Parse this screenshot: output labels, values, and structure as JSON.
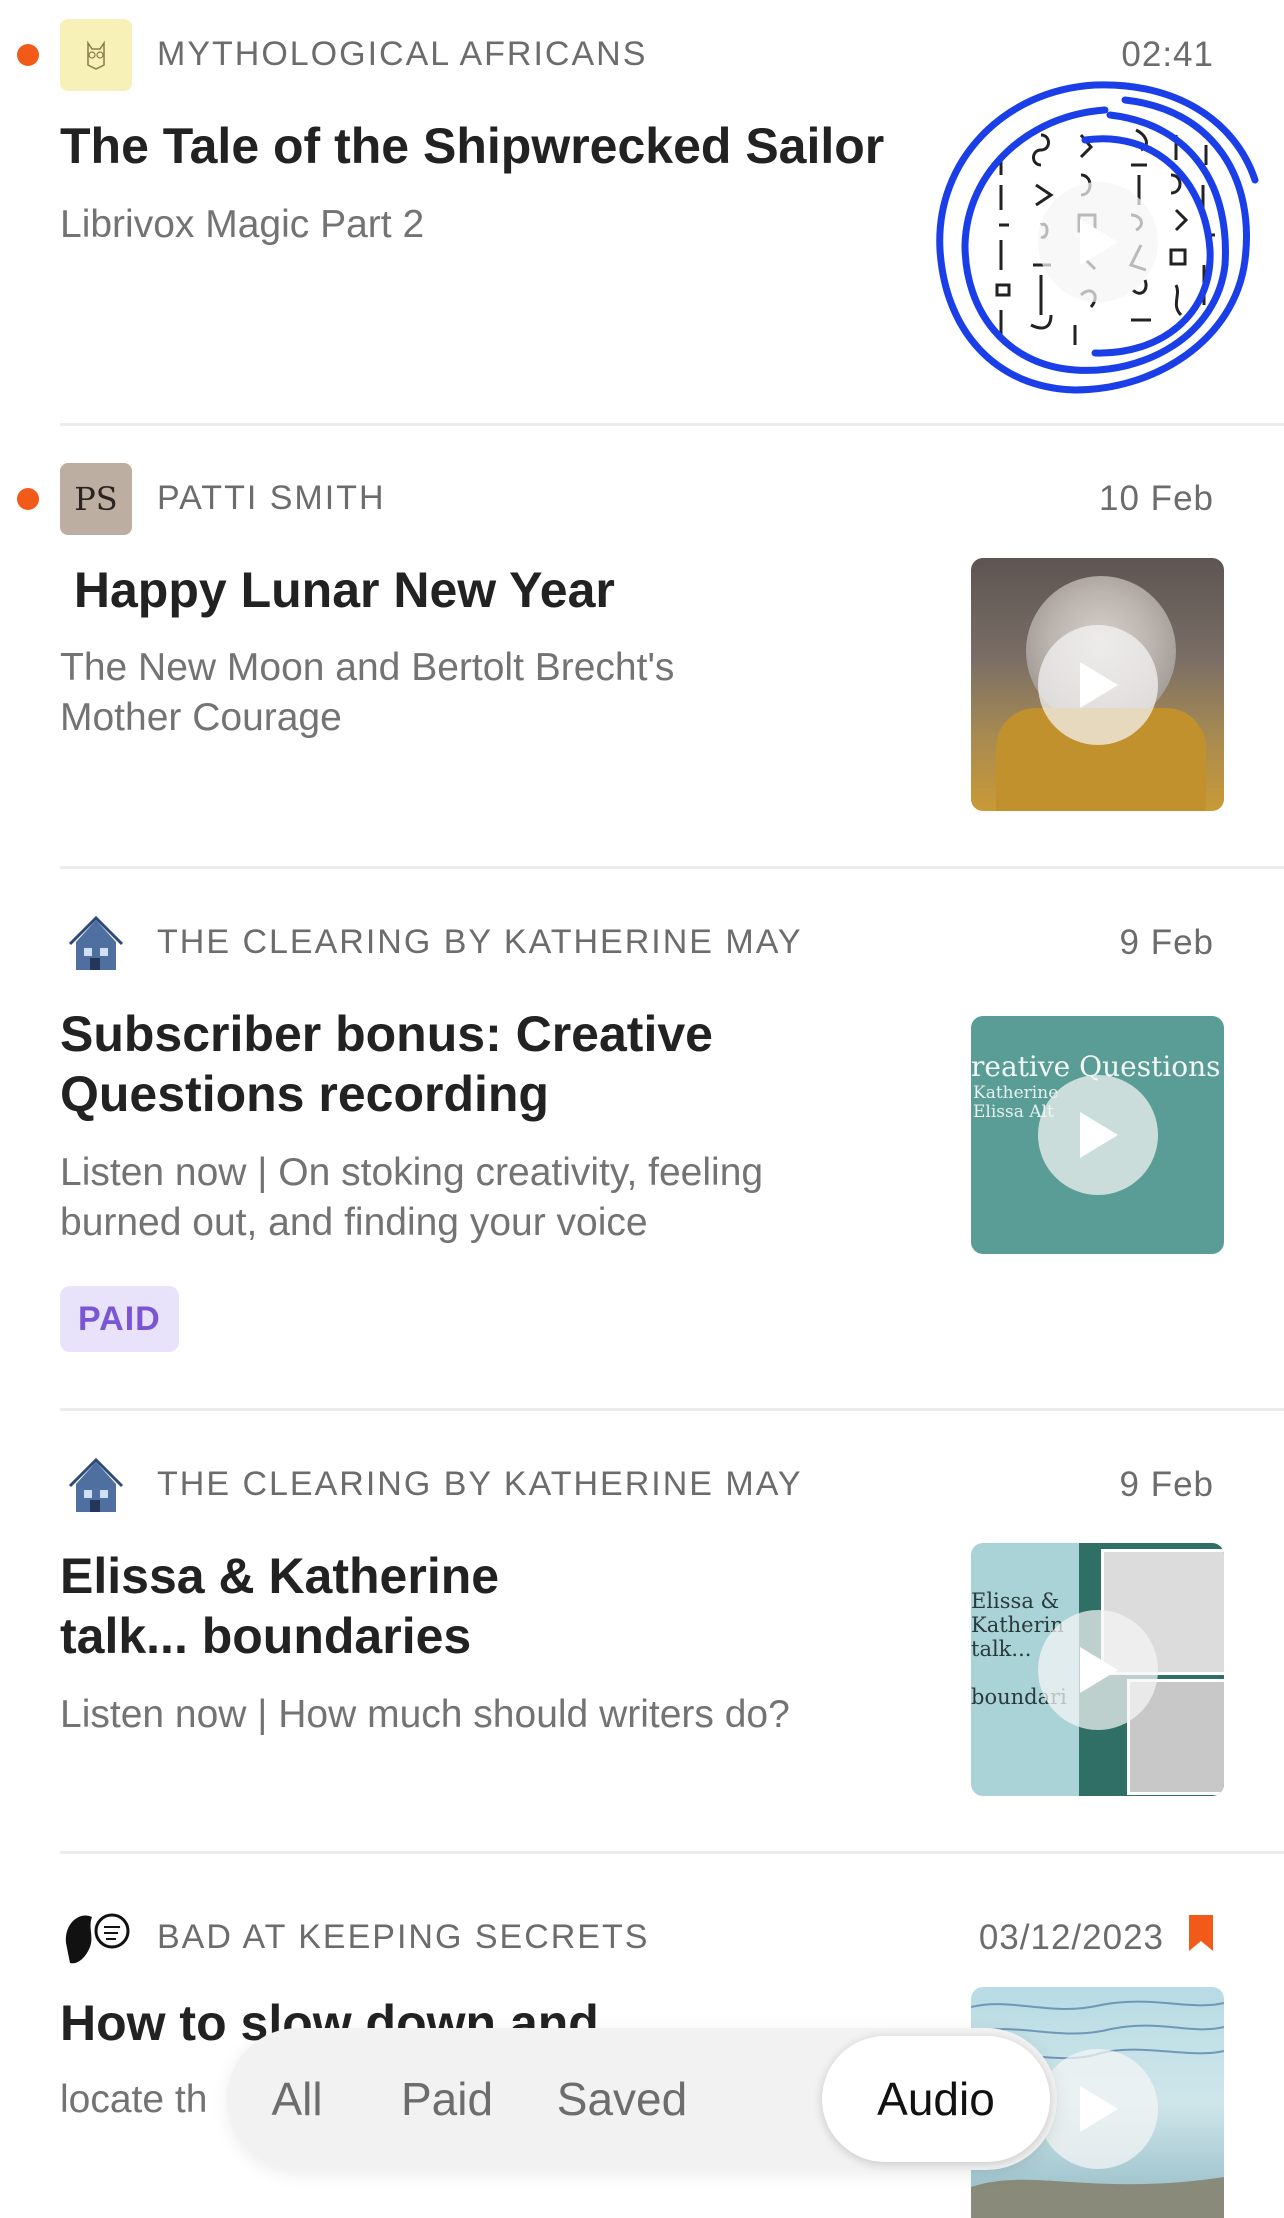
{
  "feed": {
    "items": [
      {
        "publication": "MYTHOLOGICAL AFRICANS",
        "date": "02:41",
        "title": "The Tale of the Shipwrecked Sailor",
        "subtitle": "Librivox Magic Part 2",
        "unread": true
      },
      {
        "publication": "PATTI SMITH",
        "logo_text": "PS",
        "date": "10 Feb",
        "title": " Happy Lunar New Year",
        "subtitle": "The New Moon and Bertolt Brecht's\nMother Courage",
        "unread": true
      },
      {
        "publication": "THE CLEARING BY KATHERINE MAY",
        "date": "9 Feb",
        "title": "Subscriber bonus: Creative\nQuestions recording",
        "subtitle": "Listen now | On stoking creativity, feeling\nburned out, and finding your voice",
        "badge": "PAID",
        "thumb_text": "reative Questions",
        "thumb_small": "Katherine\nElissa Alt",
        "unread": false
      },
      {
        "publication": "THE CLEARING BY KATHERINE MAY",
        "date": "9 Feb",
        "title": "Elissa & Katherine\ntalk... boundaries",
        "subtitle": "Listen now | How much should writers do?",
        "thumb_text": "Elissa &\nKatherin\ntalk...\n\nboundari",
        "unread": false
      },
      {
        "publication": "BAD AT KEEPING SECRETS",
        "date": "03/12/2023",
        "title": "How to slow down and",
        "subtitle": "locate th",
        "bookmarked": true,
        "unread": false
      }
    ]
  },
  "tabs": {
    "all": "All",
    "paid": "Paid",
    "saved": "Saved",
    "audio": "Audio",
    "active": "Audio"
  },
  "colors": {
    "unread_dot": "#f25a1a",
    "badge_bg": "#e8e2fb",
    "badge_text": "#7a55d4",
    "bookmark": "#f25a1a",
    "annotation_circle": "#1a3fe8"
  }
}
